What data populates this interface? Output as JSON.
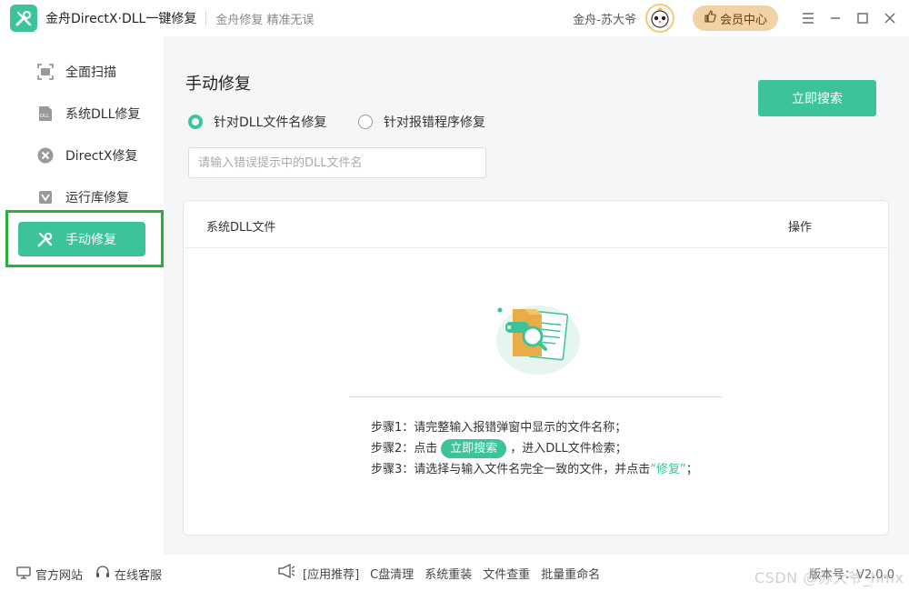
{
  "app": {
    "title": "金舟DirectX·DLL一键修复",
    "slogan": "金舟修复 精准无误",
    "user_name": "金舟-苏大爷",
    "vip_label": "会员中心",
    "accent_color": "#3dc39a"
  },
  "window_controls": [
    "menu-icon",
    "minimize-icon",
    "maximize-icon",
    "close-icon"
  ],
  "sidebar": {
    "items": [
      {
        "label": "全面扫描",
        "icon": "scan-icon"
      },
      {
        "label": "系统DLL修复",
        "icon": "dll-icon"
      },
      {
        "label": "DirectX修复",
        "icon": "directx-icon"
      },
      {
        "label": "运行库修复",
        "icon": "runtime-icon"
      },
      {
        "label": "手动修复",
        "icon": "wrench-icon",
        "active": true
      }
    ]
  },
  "main": {
    "title": "手动修复",
    "search_button": "立即搜索",
    "radio_options": [
      {
        "label": "针对DLL文件名修复",
        "selected": true
      },
      {
        "label": "针对报错程序修复",
        "selected": false
      }
    ],
    "input_placeholder": "请输入错误提示中的DLL文件名",
    "table": {
      "col_name": "系统DLL文件",
      "col_action": "操作"
    },
    "steps": {
      "step1": "步骤1：请完整输入报错弹窗中显示的文件名称；",
      "step2_prefix": "步骤2：点击",
      "step2_button": "立即搜索",
      "step2_suffix": "，进入DLL文件检索；",
      "step3_prefix": "步骤3：请选择与输入文件名完全一致的文件，并点击",
      "step3_fix": "“修复”",
      "step3_suffix": "；"
    }
  },
  "footer": {
    "official_site": "官方网站",
    "online_service": "在线客服",
    "app_recommend": "[应用推荐]",
    "links": [
      "C盘清理",
      "系统重装",
      "文件查重",
      "批量重命名"
    ],
    "version": "版本号：V2.0.0",
    "watermark": "CSDN @苏大爷_hmx"
  }
}
